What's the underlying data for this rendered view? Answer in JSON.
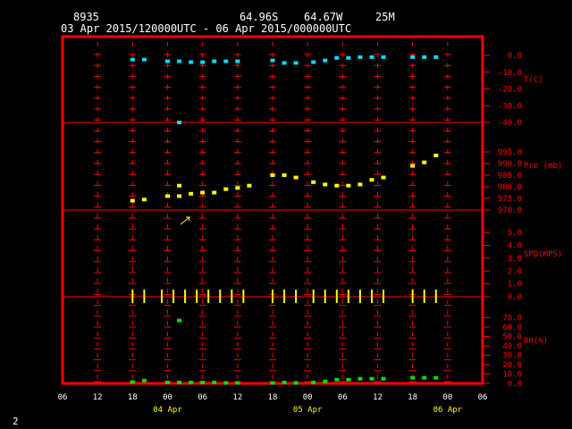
{
  "header": {
    "station": "8935",
    "lat": "64.96S",
    "lon": "64.67W",
    "elev": "25M",
    "period": "03 Apr 2015/120000UTC - 06 Apr 2015/000000UTC"
  },
  "footer": {
    "page_number": "2"
  },
  "chart_data": {
    "type": "scatter",
    "x_unit": "hours from 03 Apr 06 UTC",
    "xlim": [
      0,
      72
    ],
    "x_tick_labels": [
      "06",
      "12",
      "18",
      "00",
      "06",
      "12",
      "18",
      "00",
      "06",
      "12",
      "18",
      "00",
      "06"
    ],
    "x_tick_values": [
      0,
      6,
      12,
      18,
      24,
      30,
      36,
      42,
      48,
      54,
      60,
      66,
      72
    ],
    "date_labels": [
      {
        "text": "04 Apr",
        "x": 18
      },
      {
        "text": "05 Apr",
        "x": 42
      },
      {
        "text": "06 Apr",
        "x": 66
      }
    ],
    "colors": {
      "frame": "#ff0000",
      "T": "#00e0ff",
      "P": "#ffff00",
      "SPD": "#ffff00",
      "RH": "#00e000",
      "axis_text": "#ff0000",
      "x_text": "#ffff00",
      "grid": "#ff0000"
    },
    "panels": [
      {
        "id": "T",
        "label": "T(C)",
        "ticks": [
          "0.0",
          "-10.0",
          "-20.0",
          "-30.0",
          "-40.0"
        ],
        "tick_values": [
          0,
          -10,
          -20,
          -30,
          -40
        ],
        "ylim": [
          -40,
          0
        ],
        "points": [
          [
            12,
            -2.5
          ],
          [
            14,
            -2.5
          ],
          [
            18,
            -3.5
          ],
          [
            20,
            -3.5
          ],
          [
            22,
            -4
          ],
          [
            24,
            -4
          ],
          [
            26,
            -3.5
          ],
          [
            28,
            -3.5
          ],
          [
            30,
            -3.5
          ],
          [
            36,
            -3
          ],
          [
            38,
            -4.5
          ],
          [
            40,
            -4.5
          ],
          [
            43,
            -4
          ],
          [
            45,
            -3
          ],
          [
            47,
            -1.5
          ],
          [
            49,
            -1.5
          ],
          [
            51,
            -1
          ],
          [
            53,
            -1
          ],
          [
            55,
            -1
          ],
          [
            60,
            -1
          ],
          [
            62,
            -1
          ],
          [
            64,
            -1
          ],
          [
            20,
            -40
          ]
        ]
      },
      {
        "id": "Pre",
        "label": "Pre (mb)",
        "ticks": [
          "995.0",
          "990.0",
          "985.0",
          "980.0",
          "975.0",
          "970.0"
        ],
        "tick_values": [
          995,
          990,
          985,
          980,
          975,
          970
        ],
        "ylim": [
          970,
          1000
        ],
        "points": [
          [
            12,
            974
          ],
          [
            14,
            974.5
          ],
          [
            18,
            976
          ],
          [
            20,
            976
          ],
          [
            20,
            980.5
          ],
          [
            22,
            977
          ],
          [
            24,
            977.5
          ],
          [
            26,
            977.5
          ],
          [
            28,
            979
          ],
          [
            30,
            979.5
          ],
          [
            32,
            980.5
          ],
          [
            36,
            985
          ],
          [
            38,
            985
          ],
          [
            40,
            984
          ],
          [
            43,
            982
          ],
          [
            45,
            981
          ],
          [
            47,
            980.5
          ],
          [
            49,
            980.5
          ],
          [
            51,
            981
          ],
          [
            53,
            983
          ],
          [
            55,
            984
          ],
          [
            60,
            989
          ],
          [
            62,
            990.5
          ],
          [
            64,
            993.5
          ]
        ]
      },
      {
        "id": "SPD",
        "label": "SPD(MPS)",
        "ticks": [
          "5.0",
          "4.0",
          "3.0",
          "2.0",
          "1.0",
          "0.0"
        ],
        "tick_values": [
          5,
          4,
          3,
          2,
          1,
          0
        ],
        "ylim": [
          0,
          5.5
        ],
        "arrow_x": 21,
        "wind_ticks": [
          12,
          14,
          17,
          19,
          21,
          23,
          25,
          27,
          29,
          31,
          36,
          38,
          40,
          43,
          45,
          47,
          49,
          51,
          53,
          55,
          60,
          62,
          64
        ]
      },
      {
        "id": "RH",
        "label": "RH(%)",
        "ticks": [
          "70.0",
          "60.0",
          "50.0",
          "40.0",
          "30.0",
          "20.0",
          "10.0",
          "0.0"
        ],
        "tick_values": [
          70,
          60,
          50,
          40,
          30,
          20,
          10,
          0
        ],
        "ylim": [
          0,
          80
        ],
        "points": [
          [
            20,
            67
          ],
          [
            12,
            1.5
          ],
          [
            14,
            3
          ],
          [
            18,
            1
          ],
          [
            20,
            1
          ],
          [
            22,
            1
          ],
          [
            24,
            1
          ],
          [
            26,
            1
          ],
          [
            28,
            0.5
          ],
          [
            30,
            0.5
          ],
          [
            36,
            0.5
          ],
          [
            38,
            1
          ],
          [
            40,
            0.5
          ],
          [
            43,
            1
          ],
          [
            45,
            2
          ],
          [
            47,
            4
          ],
          [
            49,
            4
          ],
          [
            51,
            5
          ],
          [
            53,
            5
          ],
          [
            55,
            5
          ],
          [
            60,
            6
          ],
          [
            62,
            6
          ],
          [
            64,
            6
          ]
        ]
      }
    ]
  }
}
